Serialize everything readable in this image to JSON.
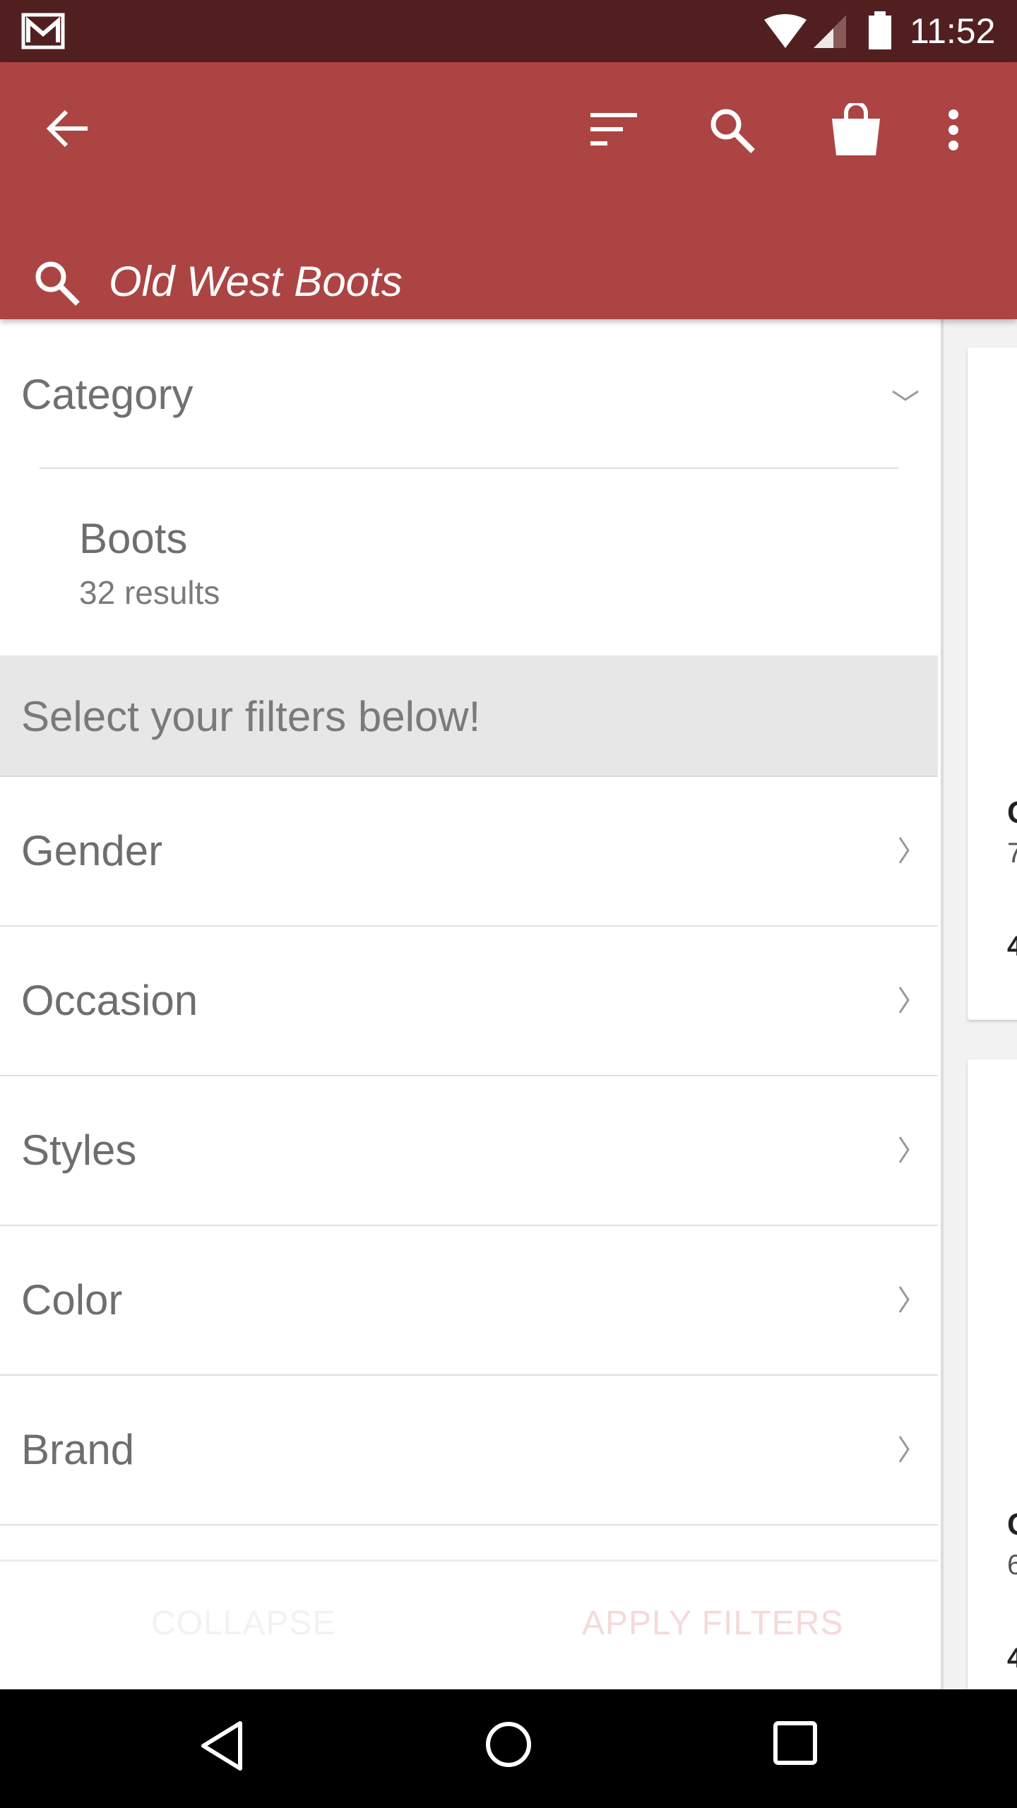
{
  "status_bar": {
    "time": "11:52",
    "icons": [
      "gmail-icon",
      "wifi-icon",
      "signal-icon",
      "battery-icon"
    ]
  },
  "app_bar": {
    "search_query": "Old West Boots",
    "icons": [
      "back-arrow-icon",
      "sort-icon",
      "search-icon",
      "shopping-bag-icon",
      "more-vert-icon"
    ],
    "color": "#ac4444"
  },
  "filters": {
    "category_title": "Category",
    "category_item": {
      "name": "Boots",
      "count": "32 results"
    },
    "banner": "Select your filters below!",
    "items": [
      {
        "label": "Gender"
      },
      {
        "label": "Occasion"
      },
      {
        "label": "Styles"
      },
      {
        "label": "Color"
      },
      {
        "label": "Brand"
      }
    ]
  },
  "actions": {
    "collapse": "COLLAPSE",
    "apply": "APPLY FILTERS"
  },
  "right_cards": [
    {
      "a": "C",
      "b": "7",
      "c": "4"
    },
    {
      "a": "C",
      "b": "6",
      "c": "4"
    }
  ],
  "colors": {
    "status_bar": "#521f20",
    "accent": "#ac4444",
    "banner": "#e7e7e7"
  }
}
